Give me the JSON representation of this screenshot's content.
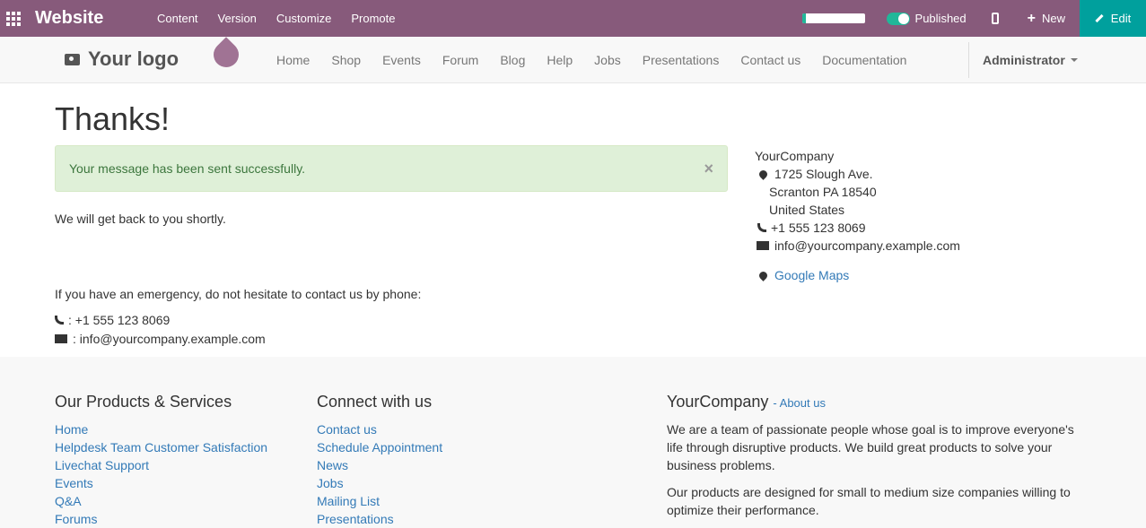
{
  "topbar": {
    "brand": "Website",
    "menu": [
      "Content",
      "Version",
      "Customize",
      "Promote"
    ],
    "progress": 0.07,
    "published_label": "Published",
    "new_label": "New",
    "edit_label": "Edit"
  },
  "navbar": {
    "logo_text": "Your logo",
    "links": [
      "Home",
      "Shop",
      "Events",
      "Forum",
      "Blog",
      "Help",
      "Jobs",
      "Presentations",
      "Contact us",
      "Documentation"
    ],
    "user": "Administrator"
  },
  "main": {
    "title": "Thanks!",
    "alert": "Your message has been sent successfully.",
    "alert_close": "×",
    "p1": "We will get back to you shortly.",
    "p2": "If you have an emergency, do not hesitate to contact us by phone:",
    "phone_line": ": +1 555 123 8069",
    "email_line": ": info@yourcompany.example.com"
  },
  "company": {
    "name": "YourCompany",
    "street": "1725 Slough Ave.",
    "city": "Scranton PA 18540",
    "country": "United States",
    "phone": "+1 555 123 8069",
    "email": "info@yourcompany.example.com",
    "maps": "Google Maps"
  },
  "footer": {
    "products_title": "Our Products & Services",
    "products": [
      "Home",
      "Helpdesk Team Customer Satisfaction",
      "Livechat Support",
      "Events",
      "Q&A",
      "Forums"
    ],
    "connect_title": "Connect with us",
    "connect": [
      "Contact us",
      "Schedule Appointment",
      "News",
      "Jobs",
      "Mailing List",
      "Presentations"
    ],
    "about_title": "YourCompany",
    "about_link": "- About us",
    "about_p1": "We are a team of passionate people whose goal is to improve everyone's life through disruptive products. We build great products to solve your business problems.",
    "about_p2": "Our products are designed for small to medium size companies willing to optimize their performance."
  },
  "colors": {
    "brand": "#875a7b",
    "edit": "#00a09d",
    "link": "#337ab7",
    "success_bg": "#dff0d8"
  }
}
